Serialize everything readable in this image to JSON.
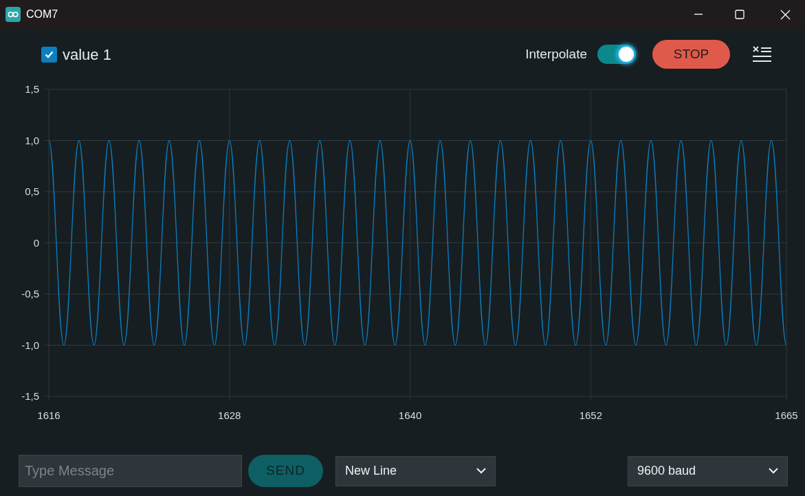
{
  "window": {
    "title": "COM7"
  },
  "toolbar": {
    "series_toggles": [
      {
        "checked": true
      }
    ],
    "interpolate": {
      "label": "Interpolate",
      "on": true
    },
    "stop_button": "STOP"
  },
  "chart": {
    "chart_data": {
      "type": "line",
      "grid": true,
      "xlim": [
        1616,
        1665
      ],
      "ylim": [
        -1.5,
        1.5
      ],
      "xticks": [
        1616,
        1628,
        1640,
        1652,
        1665
      ],
      "yticks": [
        {
          "value": 1.5,
          "label": "1,5"
        },
        {
          "value": 1,
          "label": "1,0"
        },
        {
          "value": 0.5,
          "label": "0,5"
        },
        {
          "value": 0,
          "label": "0"
        },
        {
          "value": -0.5,
          "label": "-0,5"
        },
        {
          "value": -1,
          "label": "-1,0"
        },
        {
          "value": -1.5,
          "label": "-1,5"
        }
      ],
      "x": [
        1616,
        1617,
        1618,
        1619,
        1620,
        1621,
        1622,
        1623,
        1624,
        1625,
        1626,
        1627,
        1628,
        1629,
        1630,
        1631,
        1632,
        1633,
        1634,
        1635,
        1636,
        1637,
        1638,
        1639,
        1640,
        1641,
        1642,
        1643,
        1644,
        1645,
        1646,
        1647,
        1648,
        1649,
        1650,
        1651,
        1652,
        1653,
        1654,
        1655,
        1656,
        1657,
        1658,
        1659,
        1660,
        1661,
        1662,
        1663,
        1664,
        1665
      ],
      "series": [
        {
          "name": "value 1",
          "color": "#0b7fc0",
          "values": [
            1,
            -1,
            1,
            -1,
            1,
            -1,
            1,
            -1,
            1,
            -1,
            1,
            -1,
            1,
            -1,
            1,
            -1,
            1,
            -1,
            1,
            -1,
            1,
            -1,
            1,
            -1,
            1,
            -1,
            1,
            -1,
            1,
            -1,
            1,
            -1,
            1,
            -1,
            1,
            -1,
            1,
            -1,
            1,
            -1,
            1,
            -1,
            1,
            -1,
            1,
            -1,
            1,
            -1,
            1,
            -1
          ]
        }
      ]
    }
  },
  "footer": {
    "message": {
      "placeholder": "Type Message"
    },
    "send_button": "SEND",
    "line_ending": "New Line",
    "baud_rate": "9600 baud"
  }
}
